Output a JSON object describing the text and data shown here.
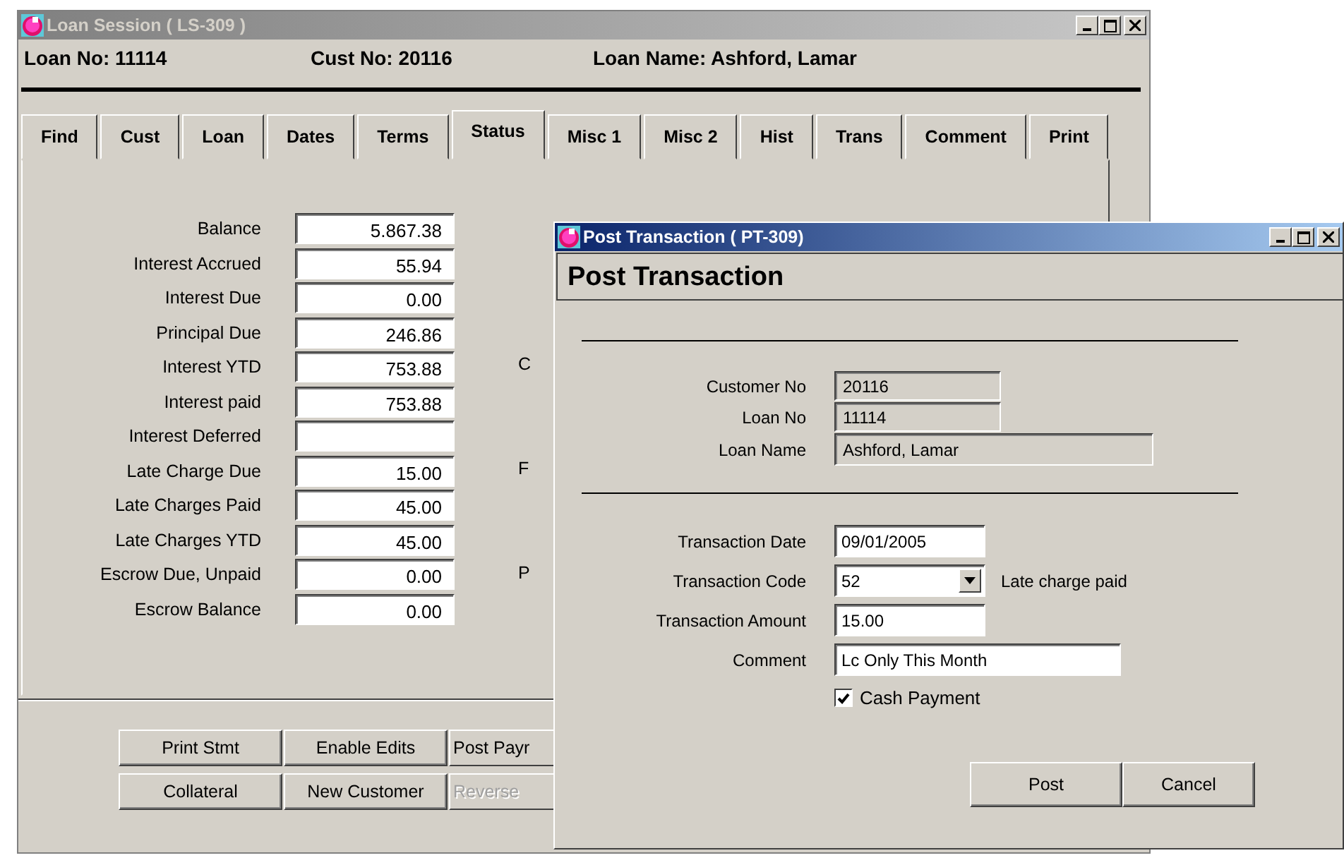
{
  "main_window": {
    "title": "Loan Session ( LS-309 )",
    "header": [
      "Loan No: 11114",
      "Cust No: 20116",
      "Loan Name: Ashford, Lamar"
    ],
    "tabs": [
      {
        "label": "Find",
        "selected": false
      },
      {
        "label": "Cust",
        "selected": false
      },
      {
        "label": "Loan",
        "selected": false
      },
      {
        "label": "Dates",
        "selected": false
      },
      {
        "label": "Terms",
        "selected": false
      },
      {
        "label": "Status",
        "selected": true
      },
      {
        "label": "Misc 1",
        "selected": false
      },
      {
        "label": "Misc 2",
        "selected": false
      },
      {
        "label": "Hist",
        "selected": false
      },
      {
        "label": "Trans",
        "selected": false
      },
      {
        "label": "Comment",
        "selected": false
      },
      {
        "label": "Print",
        "selected": false
      }
    ],
    "fields": [
      {
        "label": "Balance",
        "value": "5.867.38"
      },
      {
        "label": "Interest Accrued",
        "value": "55.94"
      },
      {
        "label": "Interest Due",
        "value": "0.00"
      },
      {
        "label": "Principal Due",
        "value": "246.86"
      },
      {
        "label": "Interest YTD",
        "value": "753.88"
      },
      {
        "label": "Interest paid",
        "value": "753.88"
      },
      {
        "label": "Interest Deferred"
      },
      {
        "label": "Late Charge Due",
        "value": "15.00"
      },
      {
        "label": "Late Charges Paid",
        "value": "45.00"
      },
      {
        "label": "Late Charges YTD",
        "value": "45.00"
      },
      {
        "label": "Escrow Due, Unpaid",
        "value": "0.00"
      },
      {
        "label": "Escrow Balance",
        "value": "0.00"
      }
    ],
    "side_labels": [
      "C",
      "F",
      "P"
    ],
    "buttons": [
      {
        "label": "Print Stmt",
        "disabled": false
      },
      {
        "label": "Enable Edits",
        "disabled": false
      },
      {
        "label": "Post Payr",
        "disabled": false
      },
      {
        "label": "Collateral",
        "disabled": false
      },
      {
        "label": "New Customer",
        "disabled": false
      },
      {
        "label": "Reverse",
        "disabled": true
      }
    ]
  },
  "dialog": {
    "title": "Post Transaction ( PT-309)",
    "heading": "Post Transaction",
    "info_fields": [
      {
        "label": "Customer No",
        "value": "20116",
        "wide": false
      },
      {
        "label": "Loan No",
        "value": "11114",
        "wide": false
      },
      {
        "label": "Loan Name",
        "value": "Ashford, Lamar",
        "wide": true
      }
    ],
    "entry_fields": [
      {
        "label": "Transaction Date",
        "value": "09/01/2005",
        "kind": "text"
      },
      {
        "label": "Transaction Code",
        "value": "52",
        "kind": "dropdown",
        "note": "Late charge paid"
      },
      {
        "label": "Transaction Amount",
        "value": "15.00",
        "kind": "text"
      },
      {
        "label": "Comment",
        "value": "Lc Only This Month",
        "kind": "wide"
      }
    ],
    "cash_payment": {
      "label": "Cash Payment",
      "checked": true
    },
    "buttons": [
      "Post",
      "Cancel"
    ]
  }
}
